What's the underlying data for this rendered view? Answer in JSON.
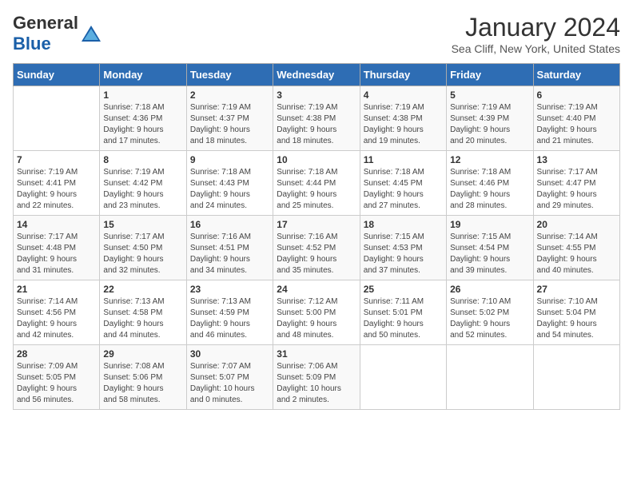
{
  "header": {
    "logo_line1": "General",
    "logo_line2": "Blue",
    "month": "January 2024",
    "location": "Sea Cliff, New York, United States"
  },
  "weekdays": [
    "Sunday",
    "Monday",
    "Tuesday",
    "Wednesday",
    "Thursday",
    "Friday",
    "Saturday"
  ],
  "weeks": [
    [
      {
        "day": "",
        "info": ""
      },
      {
        "day": "1",
        "info": "Sunrise: 7:18 AM\nSunset: 4:36 PM\nDaylight: 9 hours\nand 17 minutes."
      },
      {
        "day": "2",
        "info": "Sunrise: 7:19 AM\nSunset: 4:37 PM\nDaylight: 9 hours\nand 18 minutes."
      },
      {
        "day": "3",
        "info": "Sunrise: 7:19 AM\nSunset: 4:38 PM\nDaylight: 9 hours\nand 18 minutes."
      },
      {
        "day": "4",
        "info": "Sunrise: 7:19 AM\nSunset: 4:38 PM\nDaylight: 9 hours\nand 19 minutes."
      },
      {
        "day": "5",
        "info": "Sunrise: 7:19 AM\nSunset: 4:39 PM\nDaylight: 9 hours\nand 20 minutes."
      },
      {
        "day": "6",
        "info": "Sunrise: 7:19 AM\nSunset: 4:40 PM\nDaylight: 9 hours\nand 21 minutes."
      }
    ],
    [
      {
        "day": "7",
        "info": "Sunrise: 7:19 AM\nSunset: 4:41 PM\nDaylight: 9 hours\nand 22 minutes."
      },
      {
        "day": "8",
        "info": "Sunrise: 7:19 AM\nSunset: 4:42 PM\nDaylight: 9 hours\nand 23 minutes."
      },
      {
        "day": "9",
        "info": "Sunrise: 7:18 AM\nSunset: 4:43 PM\nDaylight: 9 hours\nand 24 minutes."
      },
      {
        "day": "10",
        "info": "Sunrise: 7:18 AM\nSunset: 4:44 PM\nDaylight: 9 hours\nand 25 minutes."
      },
      {
        "day": "11",
        "info": "Sunrise: 7:18 AM\nSunset: 4:45 PM\nDaylight: 9 hours\nand 27 minutes."
      },
      {
        "day": "12",
        "info": "Sunrise: 7:18 AM\nSunset: 4:46 PM\nDaylight: 9 hours\nand 28 minutes."
      },
      {
        "day": "13",
        "info": "Sunrise: 7:17 AM\nSunset: 4:47 PM\nDaylight: 9 hours\nand 29 minutes."
      }
    ],
    [
      {
        "day": "14",
        "info": "Sunrise: 7:17 AM\nSunset: 4:48 PM\nDaylight: 9 hours\nand 31 minutes."
      },
      {
        "day": "15",
        "info": "Sunrise: 7:17 AM\nSunset: 4:50 PM\nDaylight: 9 hours\nand 32 minutes."
      },
      {
        "day": "16",
        "info": "Sunrise: 7:16 AM\nSunset: 4:51 PM\nDaylight: 9 hours\nand 34 minutes."
      },
      {
        "day": "17",
        "info": "Sunrise: 7:16 AM\nSunset: 4:52 PM\nDaylight: 9 hours\nand 35 minutes."
      },
      {
        "day": "18",
        "info": "Sunrise: 7:15 AM\nSunset: 4:53 PM\nDaylight: 9 hours\nand 37 minutes."
      },
      {
        "day": "19",
        "info": "Sunrise: 7:15 AM\nSunset: 4:54 PM\nDaylight: 9 hours\nand 39 minutes."
      },
      {
        "day": "20",
        "info": "Sunrise: 7:14 AM\nSunset: 4:55 PM\nDaylight: 9 hours\nand 40 minutes."
      }
    ],
    [
      {
        "day": "21",
        "info": "Sunrise: 7:14 AM\nSunset: 4:56 PM\nDaylight: 9 hours\nand 42 minutes."
      },
      {
        "day": "22",
        "info": "Sunrise: 7:13 AM\nSunset: 4:58 PM\nDaylight: 9 hours\nand 44 minutes."
      },
      {
        "day": "23",
        "info": "Sunrise: 7:13 AM\nSunset: 4:59 PM\nDaylight: 9 hours\nand 46 minutes."
      },
      {
        "day": "24",
        "info": "Sunrise: 7:12 AM\nSunset: 5:00 PM\nDaylight: 9 hours\nand 48 minutes."
      },
      {
        "day": "25",
        "info": "Sunrise: 7:11 AM\nSunset: 5:01 PM\nDaylight: 9 hours\nand 50 minutes."
      },
      {
        "day": "26",
        "info": "Sunrise: 7:10 AM\nSunset: 5:02 PM\nDaylight: 9 hours\nand 52 minutes."
      },
      {
        "day": "27",
        "info": "Sunrise: 7:10 AM\nSunset: 5:04 PM\nDaylight: 9 hours\nand 54 minutes."
      }
    ],
    [
      {
        "day": "28",
        "info": "Sunrise: 7:09 AM\nSunset: 5:05 PM\nDaylight: 9 hours\nand 56 minutes."
      },
      {
        "day": "29",
        "info": "Sunrise: 7:08 AM\nSunset: 5:06 PM\nDaylight: 9 hours\nand 58 minutes."
      },
      {
        "day": "30",
        "info": "Sunrise: 7:07 AM\nSunset: 5:07 PM\nDaylight: 10 hours\nand 0 minutes."
      },
      {
        "day": "31",
        "info": "Sunrise: 7:06 AM\nSunset: 5:09 PM\nDaylight: 10 hours\nand 2 minutes."
      },
      {
        "day": "",
        "info": ""
      },
      {
        "day": "",
        "info": ""
      },
      {
        "day": "",
        "info": ""
      }
    ]
  ]
}
